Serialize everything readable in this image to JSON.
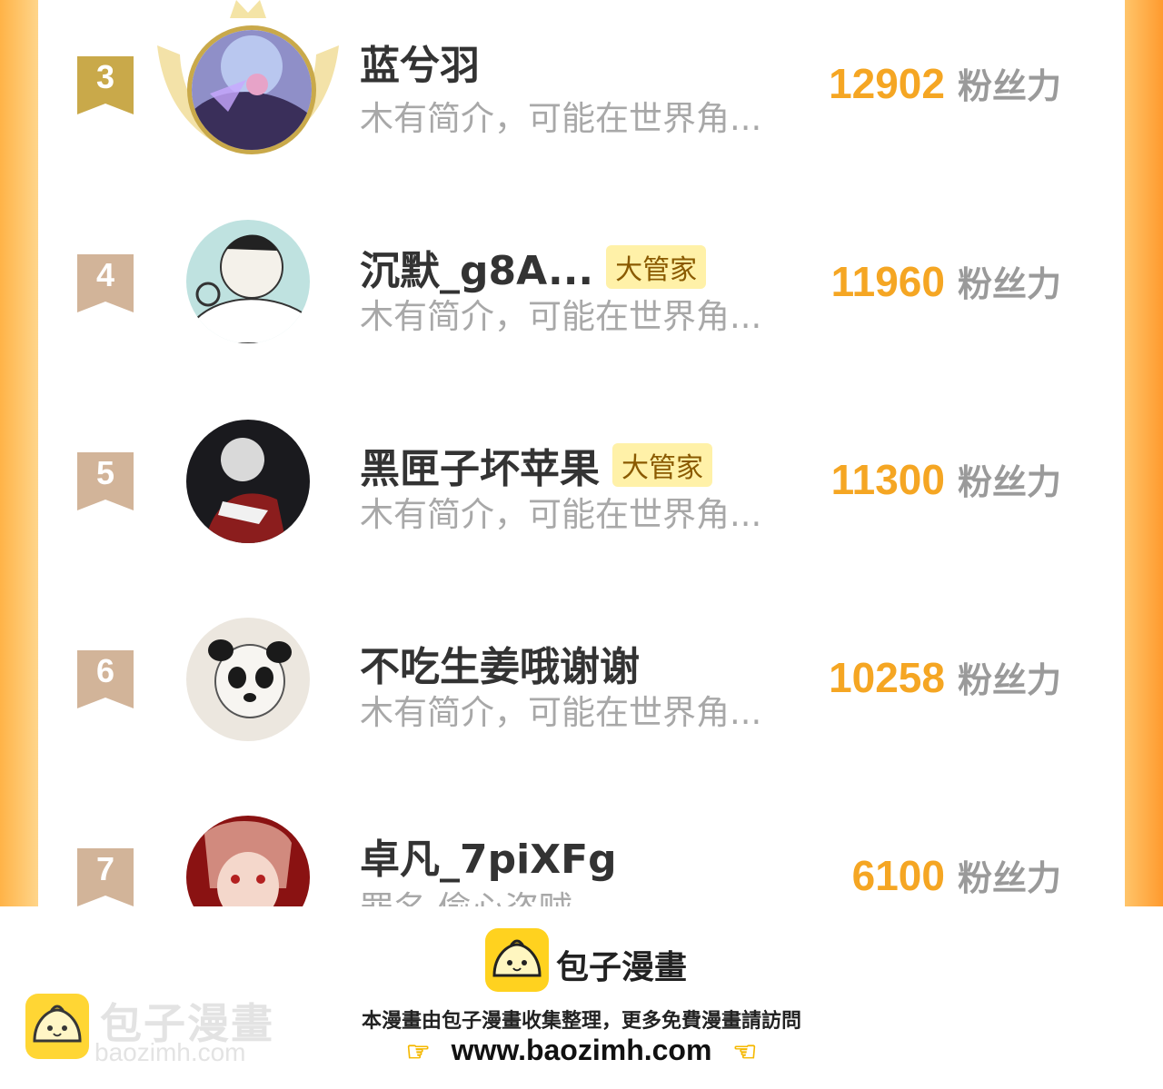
{
  "colors": {
    "accent": "#f5a623",
    "gold": "#c9a94a",
    "ribbon": "#d2b499",
    "badge_bg": "#fff1a8"
  },
  "leaderboard": [
    {
      "rank": "3",
      "name": "蓝兮羽",
      "badge": "",
      "bio": "木有简介，可能在世界角...",
      "fans": "12902",
      "fans_unit": "粉丝力"
    },
    {
      "rank": "4",
      "name": "沉默_g8A...",
      "badge": "大管家",
      "bio": "木有简介，可能在世界角...",
      "fans": "11960",
      "fans_unit": "粉丝力"
    },
    {
      "rank": "5",
      "name": "黑匣子坏苹果",
      "badge": "大管家",
      "bio": "木有简介，可能在世界角...",
      "fans": "11300",
      "fans_unit": "粉丝力"
    },
    {
      "rank": "6",
      "name": "不吃生姜哦谢谢",
      "badge": "",
      "bio": "木有简介，可能在世界角...",
      "fans": "10258",
      "fans_unit": "粉丝力"
    },
    {
      "rank": "7",
      "name": "卓凡_7piXFg",
      "badge": "",
      "bio": "罪名 偷心盗贼",
      "fans": "6100",
      "fans_unit": "粉丝力"
    }
  ],
  "footer": {
    "brand": "包子漫畫",
    "notice": "本漫畫由包子漫畫收集整理，更多免費漫畫請訪問",
    "url": "www.baozimh.com",
    "watermark_title": "包子漫畫",
    "watermark_url": "baozimh.com",
    "icons": [
      "bun-logo-icon",
      "pointing-hand-right-icon",
      "pointing-hand-left-icon"
    ]
  }
}
